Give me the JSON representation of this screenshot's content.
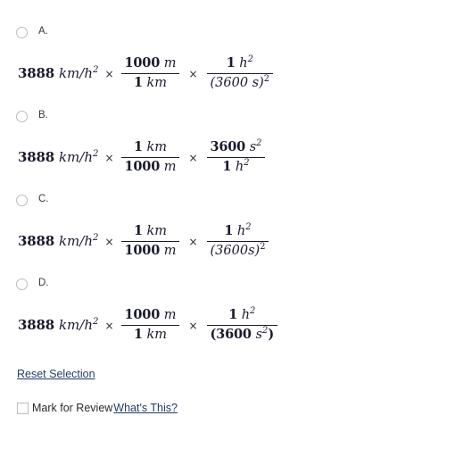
{
  "options": [
    {
      "letter": "A.",
      "lead_number": "3888",
      "lead_unit": "km/h",
      "lead_unit_exp": "2",
      "times_symbol": "×",
      "fraction1": {
        "numerator_number": "1000",
        "numerator_unit": "m",
        "denominator_number": "1",
        "denominator_unit": "km"
      },
      "fraction2": {
        "numerator_number": "1",
        "numerator_unit": "h",
        "numerator_exp": "2",
        "denominator_text": "(3600 s)",
        "denominator_exp": "2"
      }
    },
    {
      "letter": "B.",
      "lead_number": "3888",
      "lead_unit": "km/h",
      "lead_unit_exp": "2",
      "times_symbol": "×",
      "fraction1": {
        "numerator_number": "1",
        "numerator_unit": "km",
        "denominator_number": "1000",
        "denominator_unit": "m"
      },
      "fraction2": {
        "numerator_number": "3600",
        "numerator_unit": "s",
        "numerator_exp": "2",
        "denominator_number": "1",
        "denominator_unit": "h",
        "denominator_exp": "2"
      }
    },
    {
      "letter": "C.",
      "lead_number": "3888",
      "lead_unit": "km/h",
      "lead_unit_exp": "2",
      "times_symbol": "×",
      "fraction1": {
        "numerator_number": "1",
        "numerator_unit": "km",
        "denominator_number": "1000",
        "denominator_unit": "m"
      },
      "fraction2": {
        "numerator_number": "1",
        "numerator_unit": "h",
        "numerator_exp": "2",
        "denominator_text": "(3600s)",
        "denominator_exp": "2"
      }
    },
    {
      "letter": "D.",
      "lead_number": "3888",
      "lead_unit": "km/h",
      "lead_unit_exp": "2",
      "times_symbol": "×",
      "fraction1": {
        "numerator_number": "1000",
        "numerator_unit": "m",
        "denominator_number": "1",
        "denominator_unit": "km"
      },
      "fraction2": {
        "numerator_number": "1",
        "numerator_unit": "h",
        "numerator_exp": "2",
        "denominator_open": "(3600 ",
        "denominator_unit": "s",
        "denominator_exp": "2",
        "denominator_close": ")"
      }
    }
  ],
  "footer": {
    "reset_label": "Reset Selection",
    "mark_review_label": "Mark for Review",
    "whats_this_label": "What's This?",
    "link_color": "#223d6b",
    "text_color": "#2a2a2a"
  }
}
